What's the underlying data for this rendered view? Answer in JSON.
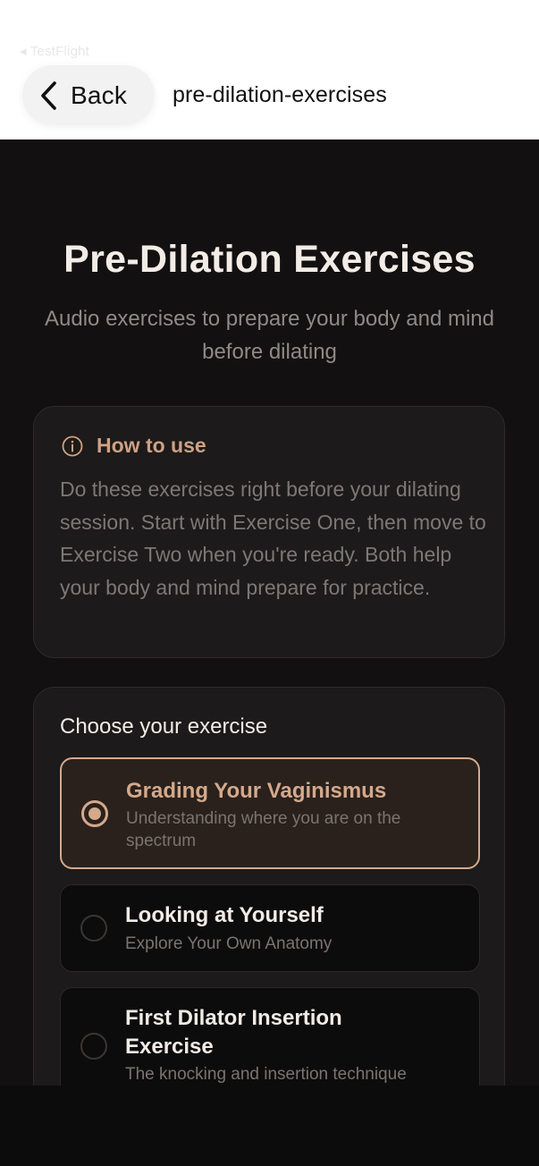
{
  "nav": {
    "testflight_label": "◂ TestFlight",
    "back_label": "Back",
    "title": "pre-dilation-exercises"
  },
  "page": {
    "title": "Pre-Dilation Exercises",
    "subtitle": "Audio exercises to prepare your body and mind before dilating"
  },
  "how_to_use": {
    "title": "How to use",
    "text": "Do these exercises right before your dilating session. Start with Exercise One, then move to Exercise Two when you're ready. Both help your body and mind prepare for practice."
  },
  "exercises": {
    "heading": "Choose your exercise",
    "selected_index": 0,
    "items": [
      {
        "title": "Grading Your Vaginismus",
        "description": "Understanding where you are on the spectrum"
      },
      {
        "title": "Looking at Yourself",
        "description": "Explore Your Own Anatomy"
      },
      {
        "title": "First Dilator Insertion Exercise",
        "description": "The knocking and insertion technique"
      }
    ]
  },
  "colors": {
    "accent": "#d4a98c",
    "background": "#121010",
    "card": "#1c1a1a",
    "text_primary": "#f3ece6",
    "text_muted": "#7d7875"
  },
  "icons": {
    "back": "chevron-left-icon",
    "info": "info-circle-icon",
    "radio_selected": "radio-selected-icon",
    "radio_unselected": "radio-unselected-icon"
  }
}
